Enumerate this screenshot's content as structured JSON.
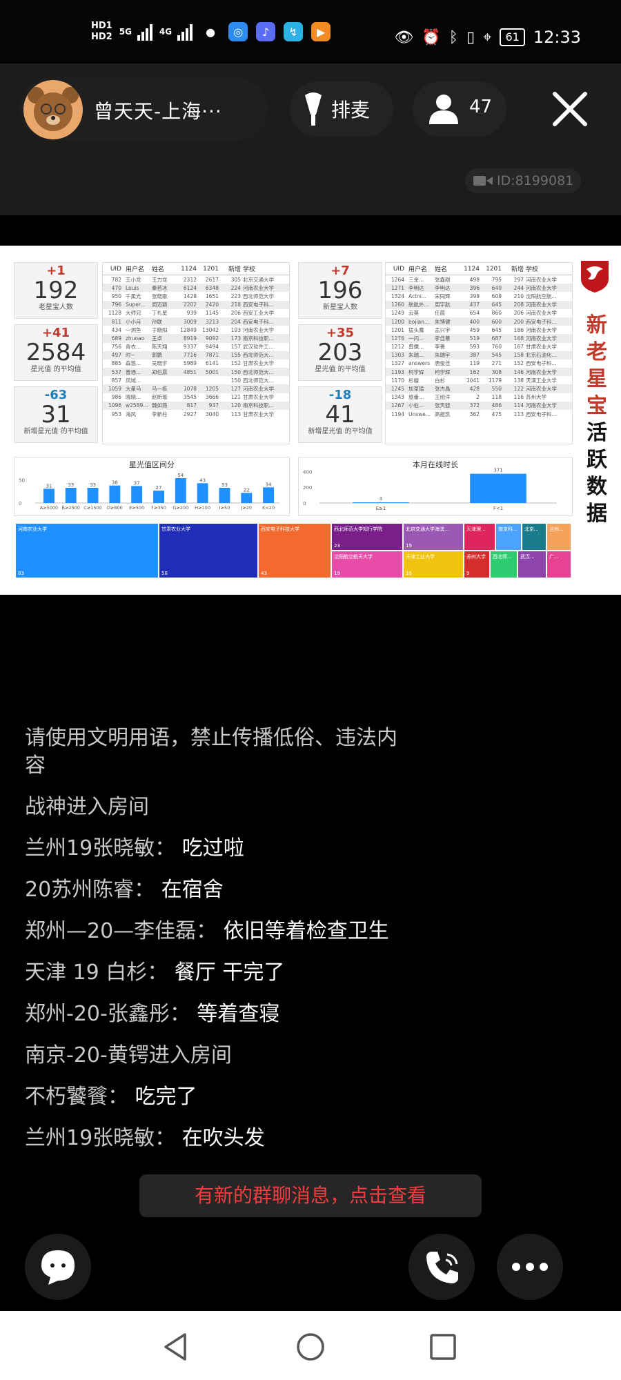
{
  "status_bar": {
    "hd1": "HD1",
    "hd2": "HD2",
    "net1": "5G",
    "net2": "4G",
    "battery": "61",
    "time": "12:33",
    "icons": [
      "wechat-icon",
      "browser-icon",
      "music-icon",
      "app-icon",
      "video-icon",
      "eye-icon",
      "alarm-icon",
      "bluetooth-icon",
      "location-icon",
      "vibrate-icon"
    ]
  },
  "header": {
    "owner_name": "曾天天-上海···",
    "mic_label": "排麦",
    "viewer_count": "47",
    "room_id": "ID:8199081"
  },
  "dashboard": {
    "side_title": [
      "新",
      "老",
      "星",
      "宝",
      "活",
      "跃",
      "数",
      "据"
    ],
    "colors": {
      "brand_red": "#c0392b",
      "blue": "#1e90ff"
    },
    "left": {
      "kpis": [
        {
          "delta": "+1",
          "value": "192",
          "caption": "老星宝人数"
        },
        {
          "delta": "+41",
          "value": "2584",
          "caption": "星光值 的平均值"
        },
        {
          "delta": "-63",
          "value": "31",
          "caption": "新增星光值 的平均值"
        }
      ],
      "table_headers": [
        "UID",
        "用户名",
        "姓名",
        "1124",
        "1201",
        "新增",
        "学校"
      ],
      "rows": [
        [
          "782",
          "王小龙",
          "王力龙",
          "2312",
          "2617",
          "305",
          "北京交通大学"
        ],
        [
          "470",
          "Louis",
          "秦若冰",
          "6124",
          "6348",
          "224",
          "河南农业大学"
        ],
        [
          "950",
          "千柔光",
          "张晓歌",
          "1428",
          "1651",
          "223",
          "西北师范大学"
        ],
        [
          "796",
          "Super...",
          "周迈颖",
          "2202",
          "2420",
          "218",
          "西安电子科..."
        ],
        [
          "1128",
          "大师兄",
          "丁礼星",
          "939",
          "1145",
          "206",
          "西安工业大学"
        ],
        [
          "811",
          "小小月",
          "孙联",
          "3009",
          "3213",
          "204",
          "西安电子科..."
        ],
        [
          "434",
          "一洞鱼",
          "于晓阳",
          "12849",
          "13042",
          "193",
          "河南农业大学"
        ],
        [
          "689",
          "zhuoao",
          "王卓",
          "8919",
          "9092",
          "173",
          "南京科技职..."
        ],
        [
          "756",
          "青衣...",
          "陈天翔",
          "9337",
          "9494",
          "157",
          "武汉软件工..."
        ],
        [
          "497",
          "时~",
          "郭鹏",
          "7716",
          "7871",
          "155",
          "西北师范大..."
        ],
        [
          "885",
          "森悠...",
          "吴晓宇",
          "5989",
          "6141",
          "152",
          "甘肃农业大学"
        ],
        [
          "537",
          "普通...",
          "郑伯晨",
          "4851",
          "5001",
          "150",
          "西北师范大..."
        ],
        [
          "857",
          "风域...",
          "",
          "",
          "",
          "150",
          "西北师范大..."
        ],
        [
          "1059",
          "大量马",
          "马一栋",
          "1078",
          "1205",
          "127",
          "河南农业大学"
        ],
        [
          "986",
          "晓晓...",
          "赵昕瑶",
          "3545",
          "3666",
          "121",
          "甘肃农业大学"
        ],
        [
          "1096",
          "w2589...",
          "魏如燕",
          "817",
          "937",
          "120",
          "南京科技职..."
        ],
        [
          "953",
          "海风",
          "李新柱",
          "2927",
          "3040",
          "113",
          "甘肃农业大学"
        ]
      ]
    },
    "right": {
      "kpis": [
        {
          "delta": "+7",
          "value": "196",
          "caption": "新星宝人数"
        },
        {
          "delta": "+35",
          "value": "203",
          "caption": "星光值 的平均值"
        },
        {
          "delta": "-18",
          "value": "41",
          "caption": "新增星光值 的平均值"
        }
      ],
      "table_headers": [
        "UID",
        "用户名",
        "姓名",
        "1124",
        "1201",
        "新增",
        "学校"
      ],
      "rows": [
        [
          "1264",
          "三金...",
          "张鑫刚",
          "498",
          "795",
          "297",
          "河南农业大学"
        ],
        [
          "1271",
          "李明达",
          "李明达",
          "396",
          "640",
          "244",
          "河南农业大学"
        ],
        [
          "1324",
          "Actni...",
          "宋同辉",
          "398",
          "608",
          "210",
          "沈阳航空航..."
        ],
        [
          "1260",
          "航航外...",
          "周宇航",
          "437",
          "645",
          "208",
          "河南农业大学"
        ],
        [
          "1249",
          "云莫",
          "任晨",
          "654",
          "860",
          "206",
          "河南农业大学"
        ],
        [
          "1200",
          "bojian...",
          "朱博健",
          "400",
          "600",
          "200",
          "西安电子科..."
        ],
        [
          "1201",
          "猛头鹰",
          "孟兴宇",
          "459",
          "645",
          "186",
          "河南农业大学"
        ],
        [
          "1276",
          "一闪...",
          "李佳慕",
          "519",
          "687",
          "168",
          "河南农业大学"
        ],
        [
          "1212",
          "曾儒...",
          "李善",
          "593",
          "760",
          "167",
          "甘肃农业大学"
        ],
        [
          "1303",
          "朱瑞...",
          "朱瑞宇",
          "387",
          "545",
          "158",
          "北京石油化..."
        ],
        [
          "1327",
          "answers",
          "唐俊佳",
          "119",
          "271",
          "152",
          "西安电子科..."
        ],
        [
          "1193",
          "柯学辉",
          "柯学辉",
          "162",
          "308",
          "146",
          "河南农业大学"
        ],
        [
          "1170",
          "杉檀",
          "白杉",
          "1041",
          "1179",
          "138",
          "天津工业大学"
        ],
        [
          "1245",
          "加草猛",
          "张杰晶",
          "428",
          "550",
          "122",
          "河南农业大学"
        ],
        [
          "1343",
          "旅番...",
          "王绍洋",
          "2",
          "118",
          "116",
          "苏州大学"
        ],
        [
          "1267",
          "小伯...",
          "张天骁",
          "372",
          "486",
          "114",
          "河南农业大学"
        ],
        [
          "1194",
          "Unswe...",
          "高振凯",
          "362",
          "475",
          "113",
          "西安电子科..."
        ]
      ]
    },
    "histogram": {
      "title": "星光值区间分",
      "chart_data": {
        "type": "bar",
        "title": "星光值区间分",
        "categories": [
          "A≥5000",
          "B≥2500",
          "C≥1500",
          "D≥800",
          "E≥500",
          "F≥350",
          "G≥200",
          "H≥100",
          "I≥50",
          "J≥20",
          "K<20"
        ],
        "values": [
          31,
          33,
          33,
          38,
          37,
          27,
          54,
          43,
          33,
          22,
          34
        ],
        "ylim": [
          0,
          60
        ],
        "y_ticks": [
          "50",
          "0"
        ]
      }
    },
    "online": {
      "title": "本月在线时长",
      "chart_data": {
        "type": "bar",
        "title": "本月在线时长",
        "categories": [
          "E≥1",
          "F<1"
        ],
        "values": [
          3,
          371
        ],
        "ylim": [
          0,
          420
        ],
        "y_ticks": [
          "400",
          "200",
          "0"
        ]
      }
    },
    "treemap": [
      {
        "name": "河南农业大学",
        "value": "83",
        "color": "#1e90ff"
      },
      {
        "name": "甘肃农业大学",
        "value": "58",
        "color": "#1f2db8"
      },
      {
        "name": "西安电子科技大学",
        "value": "43",
        "color": "#f26a2e"
      },
      {
        "name": "西北师范大学知行学院",
        "value": "23",
        "color": "#7a1f8a"
      },
      {
        "name": "北京交通大学海滨...",
        "value": "19",
        "color": "#9b59b6"
      },
      {
        "name": "天津理...",
        "value": "",
        "color": "#e0245e"
      },
      {
        "name": "南京科...",
        "value": "",
        "color": "#4aa3ff"
      },
      {
        "name": "北京...",
        "value": "",
        "color": "#1a7b8a"
      },
      {
        "name": "兰州...",
        "value": "",
        "color": "#f5a25d"
      },
      {
        "name": "沈阳航空航天大学",
        "value": "19",
        "color": "#e64ca8"
      },
      {
        "name": "天津工业大学",
        "value": "16",
        "color": "#f1c40f"
      },
      {
        "name": "苏州大学",
        "value": "9",
        "color": "#d62c2c"
      },
      {
        "name": "西北师...",
        "value": "",
        "color": "#2ecc71"
      },
      {
        "name": "武汉...",
        "value": "",
        "color": "#8e44ad"
      },
      {
        "name": "广...",
        "value": "",
        "color": "#e84393"
      }
    ]
  },
  "chat": {
    "messages": [
      {
        "type": "system",
        "text": "请使用文明用语，禁止传播低俗、违法内容"
      },
      {
        "type": "system",
        "text": "战神进入房间"
      },
      {
        "type": "user",
        "name": "兰州19张晓敏：",
        "text": "吃过啦"
      },
      {
        "type": "user",
        "name": "20苏州陈睿：",
        "text": "在宿舍"
      },
      {
        "type": "user",
        "name": "郑州—20—李佳磊：",
        "text": "依旧等着检查卫生"
      },
      {
        "type": "user",
        "name": "天津 19 白杉：",
        "text": "餐厅 干完了"
      },
      {
        "type": "user",
        "name": "郑州-20-张鑫彤：",
        "text": "等着查寝"
      },
      {
        "type": "system",
        "text": "南京-20-黄锷进入房间"
      },
      {
        "type": "user",
        "name": "不朽饕餮：",
        "text": "吃完了"
      },
      {
        "type": "user",
        "name": "兰州19张晓敏：",
        "text": "在吹头发"
      }
    ],
    "new_message_notice": "有新的群聊消息，点击查看"
  }
}
